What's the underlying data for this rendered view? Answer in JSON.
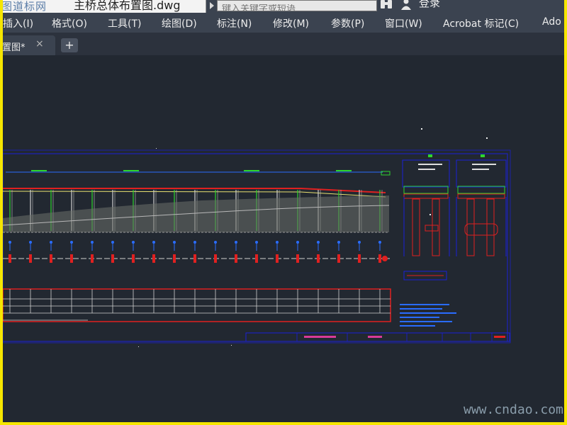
{
  "titlebar": {
    "logo_text": "图道标网",
    "document_title": "主桥总体布置图.dwg",
    "search_placeholder": "键入关键字或短语",
    "login_label": "登录"
  },
  "menu": [
    {
      "label": "插入(I)"
    },
    {
      "label": "格式(O)"
    },
    {
      "label": "工具(T)"
    },
    {
      "label": "绘图(D)"
    },
    {
      "label": "标注(N)"
    },
    {
      "label": "修改(M)"
    },
    {
      "label": "参数(P)"
    },
    {
      "label": "窗口(W)"
    },
    {
      "label": "Acrobat 标记(C)"
    },
    {
      "label": "Ado"
    }
  ],
  "tabs": [
    {
      "label": "置图*"
    }
  ],
  "tab_add_label": "+",
  "tab_close_label": "×",
  "watermark": "www.cndao.com",
  "colors": {
    "accent_border": "#f6e600",
    "canvas_background": "#222831",
    "menu_background": "#3b4350",
    "drawing_frame": "#1a20d8",
    "drawing_red": "#d82020",
    "drawing_green": "#2ed62e"
  },
  "icons": {
    "search_icon": "binoculars-icon",
    "user_icon": "user-icon",
    "close_icon": "close-icon",
    "add_icon": "plus-icon"
  }
}
